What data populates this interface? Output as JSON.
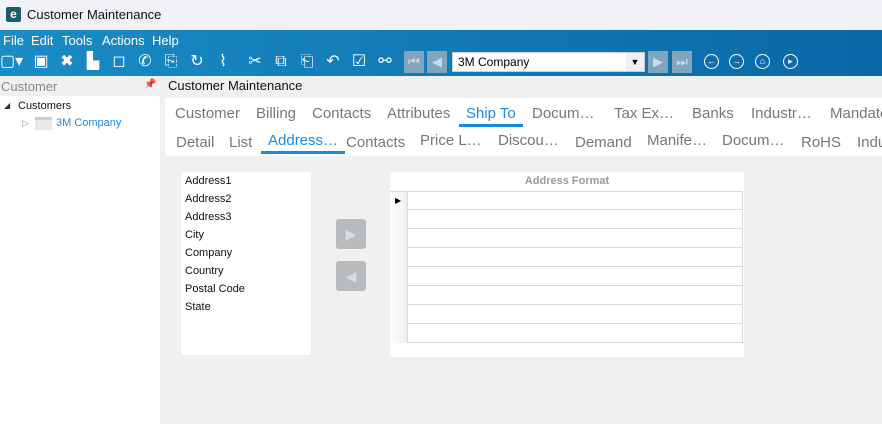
{
  "window": {
    "title": "Customer Maintenance",
    "logo": "e"
  },
  "menu": [
    "File",
    "Edit",
    "Tools",
    "Actions",
    "Help"
  ],
  "toolbar": {
    "icons": [
      "new-icon",
      "save-icon",
      "delete-icon",
      "print-icon",
      "note-icon",
      "phone-icon",
      "attach-icon",
      "refresh-icon",
      "clear-icon",
      "cut-icon",
      "copy-icon",
      "paste-icon",
      "undo-icon",
      "clipboard-icon",
      "search-icon"
    ],
    "record": "3M Company"
  },
  "left_panel": {
    "title": "Customer",
    "tree": {
      "root": "Customers",
      "child": "3M Company"
    }
  },
  "main": {
    "title": "Customer Maintenance",
    "tabs1": [
      "Customer",
      "Billing",
      "Contacts",
      "Attributes",
      "Ship To",
      "Docum…",
      "Tax Ex…",
      "Banks",
      "Industr…",
      "Mandate"
    ],
    "tabs2": [
      "Detail",
      "List",
      "Address…",
      "Contacts",
      "Price L…",
      "Discou…",
      "Demand",
      "Manife…",
      "Docum…",
      "RoHS",
      "Indu"
    ],
    "active1": "Ship To",
    "active2": "Address…",
    "fields": [
      "Address1",
      "Address2",
      "Address3",
      "City",
      "Company",
      "Country",
      "Postal Code",
      "State"
    ],
    "grid_header": "Address Format"
  },
  "accent": "#1a8ae0"
}
